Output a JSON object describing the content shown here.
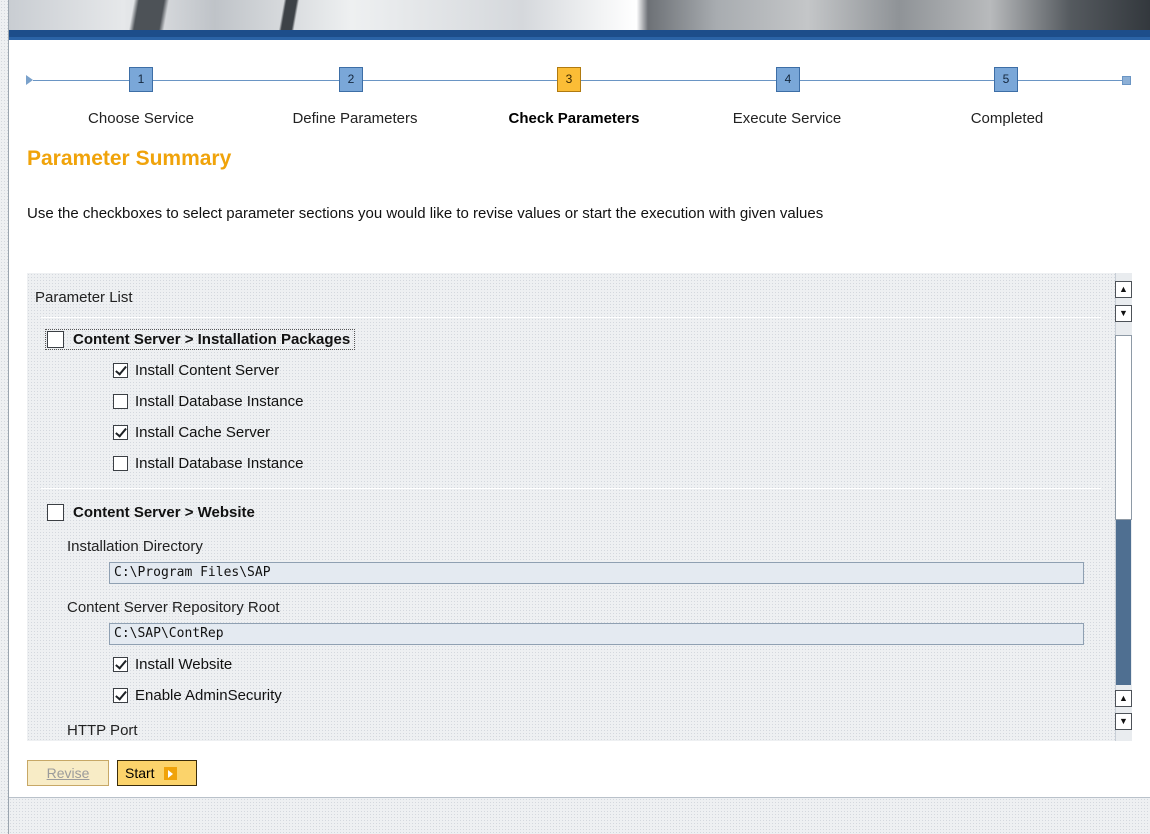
{
  "roadmap": {
    "steps": [
      {
        "number": "1",
        "label": "Choose Service"
      },
      {
        "number": "2",
        "label": "Define Parameters"
      },
      {
        "number": "3",
        "label": "Check Parameters"
      },
      {
        "number": "4",
        "label": "Execute Service"
      },
      {
        "number": "5",
        "label": "Completed"
      }
    ],
    "active_step": "3"
  },
  "page": {
    "title": "Parameter Summary",
    "instruction": "Use the checkboxes to select parameter sections you would like to revise values or start the execution with given values"
  },
  "parameter_list": {
    "title": "Parameter List",
    "sections": [
      {
        "title": "Content Server > Installation Packages",
        "checked": false,
        "items": [
          {
            "label": "Install Content Server",
            "checked": true
          },
          {
            "label": "Install Database Instance",
            "checked": false
          },
          {
            "label": "Install Cache Server",
            "checked": true
          },
          {
            "label": "Install Database Instance",
            "checked": false
          }
        ]
      },
      {
        "title": "Content Server > Website",
        "checked": false,
        "fields": [
          {
            "label": "Installation Directory",
            "value": "C:\\Program Files\\SAP"
          },
          {
            "label": "Content Server Repository Root",
            "value": "C:\\SAP\\ContRep"
          }
        ],
        "items": [
          {
            "label": "Install Website",
            "checked": true
          },
          {
            "label": "Enable AdminSecurity",
            "checked": true
          }
        ],
        "trailing_label": "HTTP Port"
      }
    ]
  },
  "scrollbar": {
    "up_glyph": "▲",
    "down_glyph": "▼"
  },
  "buttons": {
    "revise": "Revise",
    "start": "Start"
  },
  "colors": {
    "accent": "#f0a30a",
    "step_box": "#7aa7d8",
    "step_active": "#fbbd36",
    "banner_blue": "#1d4d8a"
  }
}
